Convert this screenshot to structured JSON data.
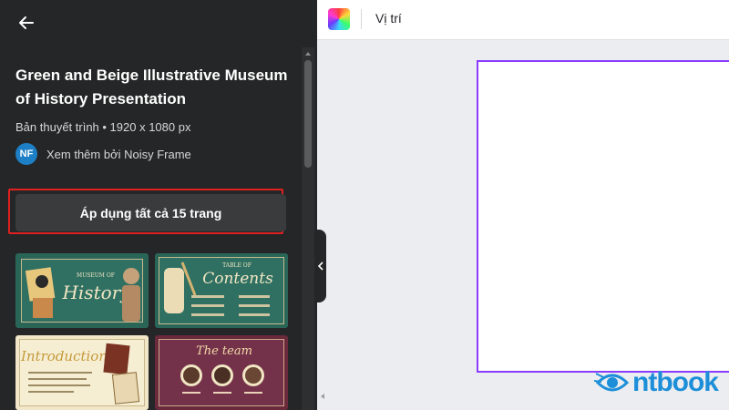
{
  "panel": {
    "title": "Green and Beige Illustrative Museum of History Presentation",
    "meta": "Bản thuyết trình • 1920 x 1080 px",
    "author_initials": "NF",
    "author_link": "Xem thêm bởi Noisy Frame",
    "apply_button": "Áp dụng tất cả 15 trang",
    "thumbnails": [
      {
        "line1": "MUSEUM OF",
        "line2": "History"
      },
      {
        "line1": "TABLE OF",
        "line2": "Contents"
      },
      {
        "line1": "",
        "line2": "Introduction"
      },
      {
        "line1": "",
        "line2": "The team"
      }
    ]
  },
  "topbar": {
    "position_label": "Vị trí"
  },
  "watermark": {
    "text": "ntbook"
  },
  "colors": {
    "panel_bg": "#252627",
    "accent_purple": "#8b3dff",
    "highlight_red": "#e02020",
    "logo_blue": "#1d8fd9"
  }
}
